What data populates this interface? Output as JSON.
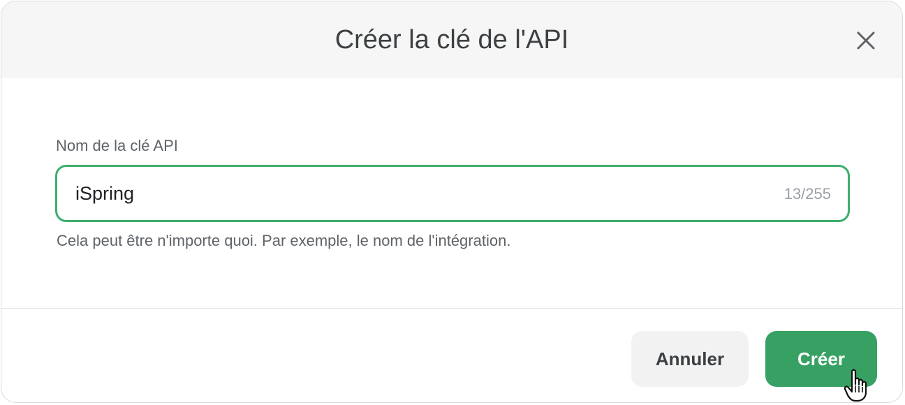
{
  "dialog": {
    "title": "Créer la clé de l'API",
    "close_icon": "close-icon"
  },
  "form": {
    "field_label": "Nom de la clé API",
    "input_value": "iSpring",
    "counter": "13/255",
    "hint": "Cela peut être n'importe quoi. Par exemple, le nom de l'intégration.",
    "focus_color": "#3dae6c"
  },
  "footer": {
    "cancel_label": "Annuler",
    "create_label": "Créer",
    "primary_color": "#37a164"
  },
  "cursor": {
    "icon": "hand-pointer-icon"
  }
}
